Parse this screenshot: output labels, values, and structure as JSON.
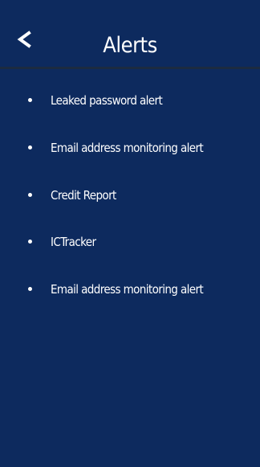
{
  "header": {
    "back_icon": "chevron-left-icon",
    "title": "Alerts"
  },
  "alerts": [
    {
      "label": "Leaked password alert"
    },
    {
      "label": "Email address monitoring alert"
    },
    {
      "label": "Credit Report"
    },
    {
      "label": "ICTracker"
    },
    {
      "label": "Email address monitoring alert"
    }
  ],
  "colors": {
    "background": "#0d2a5e",
    "text": "#ffffff",
    "divider": "#1c2b40"
  }
}
